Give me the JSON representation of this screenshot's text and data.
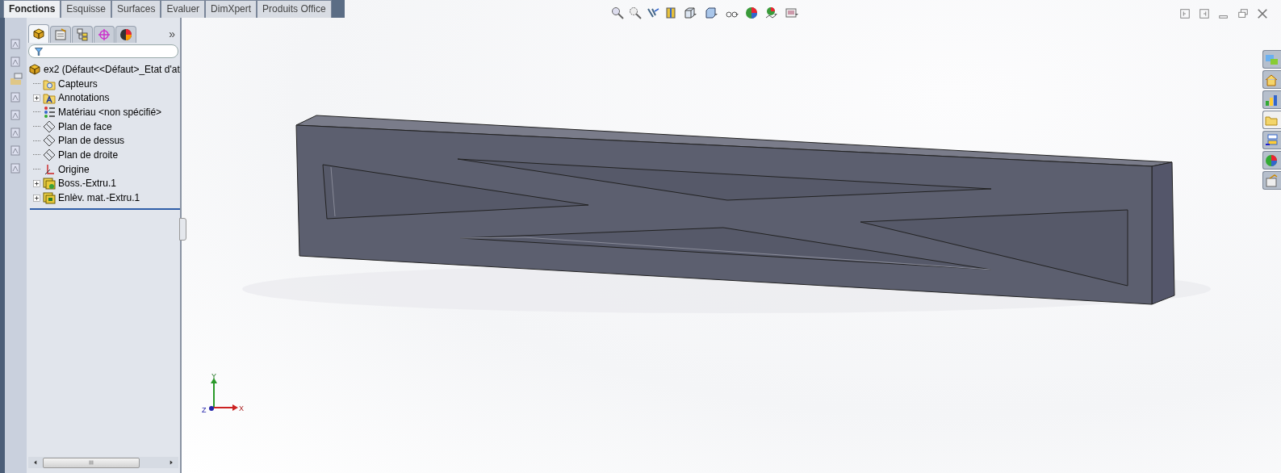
{
  "command_tabs": [
    {
      "label": "Fonctions",
      "selected": true
    },
    {
      "label": "Esquisse",
      "selected": false
    },
    {
      "label": "Surfaces",
      "selected": false
    },
    {
      "label": "Evaluer",
      "selected": false
    },
    {
      "label": "DimXpert",
      "selected": false
    },
    {
      "label": "Produits Office",
      "selected": false
    }
  ],
  "manager_tabs": [
    {
      "kind": "feature",
      "selected": true
    },
    {
      "kind": "property",
      "selected": false
    },
    {
      "kind": "config",
      "selected": false
    },
    {
      "kind": "dimxpert",
      "selected": false
    },
    {
      "kind": "display",
      "selected": false
    }
  ],
  "manager_more": "»",
  "feature_tree": {
    "root": "ex2  (Défaut<<Défaut>_Etat d'at",
    "items": [
      {
        "label": "Capteurs",
        "kind": "sensor",
        "expander": false
      },
      {
        "label": "Annotations",
        "kind": "annotations",
        "expander": true
      },
      {
        "label": "Matériau <non spécifié>",
        "kind": "material",
        "expander": false
      },
      {
        "label": "Plan de face",
        "kind": "plane",
        "expander": false
      },
      {
        "label": "Plan de dessus",
        "kind": "plane",
        "expander": false
      },
      {
        "label": "Plan de droite",
        "kind": "plane",
        "expander": false
      },
      {
        "label": "Origine",
        "kind": "origin",
        "expander": false
      },
      {
        "label": "Boss.-Extru.1",
        "kind": "boss",
        "expander": true
      },
      {
        "label": "Enlèv. mat.-Extru.1",
        "kind": "cut",
        "expander": true
      }
    ]
  },
  "task_pane_tabs": [
    {
      "kind": "community",
      "selected": false
    },
    {
      "kind": "home",
      "selected": false
    },
    {
      "kind": "chart",
      "selected": false
    },
    {
      "kind": "folder",
      "selected": true
    },
    {
      "kind": "library",
      "selected": false
    },
    {
      "kind": "appearance",
      "selected": false
    },
    {
      "kind": "clipboard",
      "selected": false
    }
  ],
  "triad": {
    "x": "X",
    "y": "Y",
    "z": "Z"
  }
}
